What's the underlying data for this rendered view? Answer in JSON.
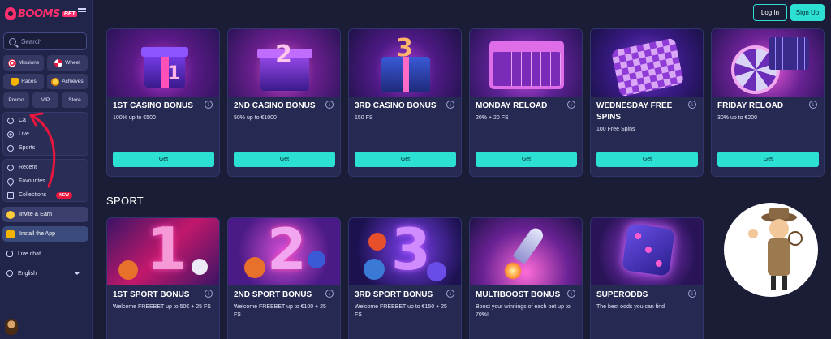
{
  "brand": {
    "logo_text": "BOOMS",
    "logo_suffix": "BET"
  },
  "header": {
    "login_label": "Log In",
    "signup_label": "Sign Up"
  },
  "sidebar": {
    "search_placeholder": "Search",
    "quick_buttons": [
      {
        "label": "Missions",
        "icon": "target-icon"
      },
      {
        "label": "Wheel",
        "icon": "wheel-icon"
      },
      {
        "label": "Races",
        "icon": "trophy-icon"
      },
      {
        "label": "Achieves",
        "icon": "medal-icon"
      }
    ],
    "tabs": [
      {
        "label": "Promo"
      },
      {
        "label": "VIP"
      },
      {
        "label": "Store"
      }
    ],
    "nav_main": [
      {
        "label": "Ca",
        "icon": "casino-icon"
      },
      {
        "label": "Live",
        "icon": "live-icon"
      },
      {
        "label": "Sports",
        "icon": "sports-icon"
      }
    ],
    "nav_lists": [
      {
        "label": "Recent",
        "icon": "clock-icon"
      },
      {
        "label": "Favourites",
        "icon": "heart-icon"
      },
      {
        "label": "Collections",
        "icon": "book-icon",
        "badge": "NEW"
      }
    ],
    "invite_label": "Invite & Earn",
    "install_label": "Install the App",
    "live_chat_label": "Live chat",
    "language_label": "English"
  },
  "sections": {
    "sport_title": "SPORT"
  },
  "casino_cards": [
    {
      "title": "1ST CASINO BONUS",
      "subtitle": "100% up to €500",
      "button": "Get",
      "art": "gift-1"
    },
    {
      "title": "2ND CASINO BONUS",
      "subtitle": "50% up to €1000",
      "button": "Get",
      "art": "gift-2"
    },
    {
      "title": "3RD CASINO BONUS",
      "subtitle": "150 FS",
      "button": "Get",
      "art": "gift-3"
    },
    {
      "title": "MONDAY RELOAD",
      "subtitle": "20% + 20 FS",
      "button": "Get",
      "art": "calendar"
    },
    {
      "title": "WEDNESDAY FREE SPINS",
      "subtitle": "100 Free Spins",
      "button": "Get",
      "art": "calendar-checker"
    },
    {
      "title": "FRIDAY RELOAD",
      "subtitle": "30% up to €200",
      "button": "Get",
      "art": "roulette"
    }
  ],
  "sport_cards": [
    {
      "title": "1ST SPORT BONUS",
      "subtitle": "Welcome FREEBET up to 50€ + 25 FS",
      "numeral": "1"
    },
    {
      "title": "2ND SPORT BONUS",
      "subtitle": "Welcome FREEBET up to €100 + 25 FS",
      "numeral": "2"
    },
    {
      "title": "3RD SPORT BONUS",
      "subtitle": "Welcome FREEBET up to €150 + 25 FS",
      "numeral": "3"
    },
    {
      "title": "MULTIBOOST BONUS",
      "subtitle": "Boost your winnings of each bet up to 70%!",
      "art": "rocket"
    },
    {
      "title": "SUPERODDS",
      "subtitle": "The best odds you can find",
      "art": "dice"
    }
  ],
  "colors": {
    "accent": "#2de0d4",
    "brand": "#ff2f6d",
    "background": "#1a1d35",
    "card": "#262a52"
  }
}
